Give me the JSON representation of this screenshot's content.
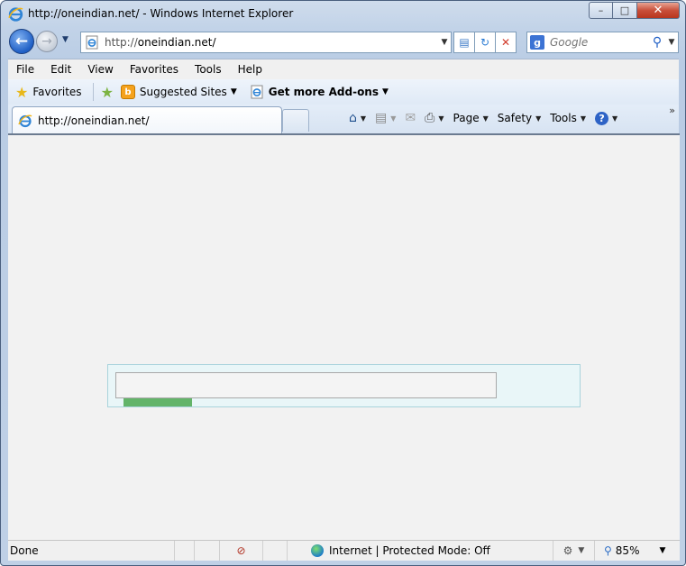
{
  "window": {
    "title": "http://oneindian.net/ - Windows Internet Explorer",
    "controls": {
      "minimize": "–",
      "maximize": "□",
      "close": "✕"
    }
  },
  "nav": {
    "address": "http://oneindian.net/",
    "address_prefix": "http://",
    "address_domain": "oneindian.net/",
    "search_placeholder": "Google"
  },
  "menu": [
    "File",
    "Edit",
    "View",
    "Favorites",
    "Tools",
    "Help"
  ],
  "favorites_bar": {
    "favorites_label": "Favorites",
    "suggested_sites": "Suggested Sites",
    "get_addons": "Get more Add-ons"
  },
  "tabs": [
    {
      "label": "http://oneindian.net/"
    }
  ],
  "command_bar": {
    "page": "Page",
    "safety": "Safety",
    "tools": "Tools"
  },
  "loader": {
    "progress": 0.18
  },
  "status": {
    "text": "Done",
    "zone": "Internet | Protected Mode: Off",
    "zoom": "85%"
  },
  "colors": {
    "progress_fill": "#63b469",
    "loader_panel": "#e9f6f8",
    "content_bg": "#f2f2f2"
  }
}
